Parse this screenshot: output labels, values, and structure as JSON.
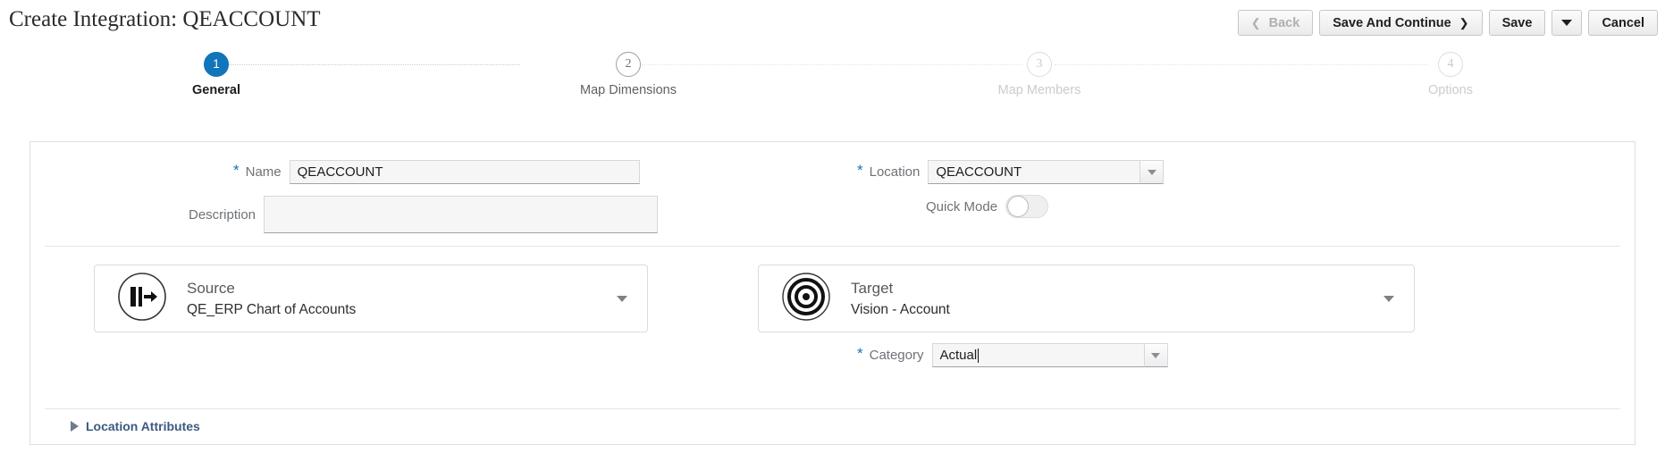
{
  "header": {
    "title": "Create Integration: QEACCOUNT",
    "buttons": [
      {
        "label": "Back",
        "icon": "chevron-left-icon",
        "disabled": true
      },
      {
        "label": "Save And Continue",
        "icon": "chevron-right-icon",
        "disabled": false
      },
      {
        "label": "Save",
        "disabled": false
      },
      {
        "label": "",
        "icon": "caret-down-icon",
        "disabled": false
      },
      {
        "label": "Cancel",
        "disabled": false
      }
    ]
  },
  "stepper": {
    "steps": [
      {
        "number": "1",
        "label": "General",
        "state": "active"
      },
      {
        "number": "2",
        "label": "Map Dimensions",
        "state": "enabled"
      },
      {
        "number": "3",
        "label": "Map Members",
        "state": "disabled"
      },
      {
        "number": "4",
        "label": "Options",
        "state": "disabled"
      }
    ]
  },
  "form": {
    "name": {
      "label": "Name",
      "value": "QEACCOUNT",
      "required": true,
      "required_mark": "*"
    },
    "description": {
      "label": "Description",
      "value": "",
      "placeholder": "",
      "required": false
    },
    "location": {
      "label": "Location",
      "value": "QEACCOUNT",
      "required": true,
      "required_mark": "*"
    },
    "quick_mode": {
      "label": "Quick Mode",
      "state": "off"
    },
    "category": {
      "label": "Category",
      "value": "Actual",
      "required": true,
      "required_mark": "*"
    }
  },
  "source": {
    "title": "Source",
    "value": "QE_ERP Chart of Accounts",
    "icon": "source-bars-arrow-icon"
  },
  "target": {
    "title": "Target",
    "value": "Vision - Account",
    "icon": "target-bullseye-icon"
  },
  "location_attributes": {
    "label": "Location Attributes",
    "expanded": false,
    "icon": "triangle-right-icon"
  },
  "colors": {
    "accent": "#1175ba",
    "link": "#3c5a82",
    "label_gray": "#6e7276",
    "disabled_gray": "#c9cdd0"
  }
}
